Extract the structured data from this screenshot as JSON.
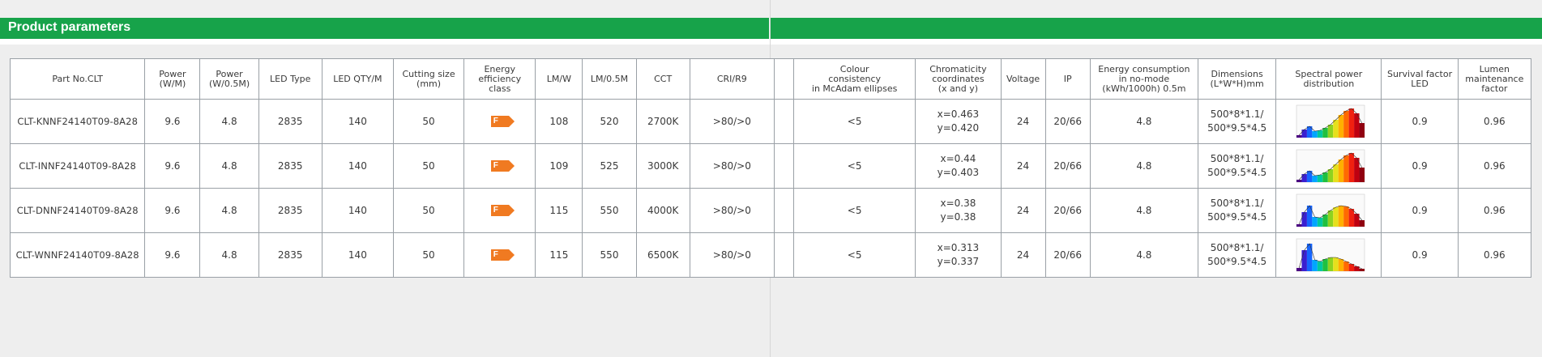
{
  "header": {
    "title": "Product parameters"
  },
  "table": {
    "headers": [
      "Part No.CLT",
      "Power\n(W/M)",
      "Power\n(W/0.5M)",
      "LED Type",
      "LED QTY/M",
      "Cutting size\n(mm)",
      "Energy\nefficiency\nclass",
      "LM/W",
      "LM/0.5M",
      "CCT",
      "CRI/R9",
      "",
      "Colour\nconsistency\nin McAdam ellipses",
      "Chromaticity\ncoordinates\n(x and y)",
      "Voltage",
      "IP",
      "Energy consumption\nin no-mode\n(kWh/1000h) 0.5m",
      "Dimensions\n(L*W*H)mm",
      "Spectral power\ndistribution",
      "Survival factor\nLED",
      "Lumen\nmaintenance\nfactor"
    ],
    "rows": [
      {
        "part_no": "CLT-KNNF24140T09-8A28",
        "power_m": "9.6",
        "power_half": "4.8",
        "led_type": "2835",
        "led_qty": "140",
        "cutting": "50",
        "energy_class": "F",
        "lmw": "108",
        "lm_half": "520",
        "cct": "2700K",
        "cri": ">80/>0",
        "mcadam": "<5",
        "chroma": "x=0.463\ny=0.420",
        "voltage": "24",
        "ip": "20/66",
        "consumption": "4.8",
        "dimensions": "500*8*1.1/\n500*9.5*4.5",
        "spectrum": "warm",
        "survival": "0.9",
        "lumen_maint": "0.96"
      },
      {
        "part_no": "CLT-INNF24140T09-8A28",
        "power_m": "9.6",
        "power_half": "4.8",
        "led_type": "2835",
        "led_qty": "140",
        "cutting": "50",
        "energy_class": "F",
        "lmw": "109",
        "lm_half": "525",
        "cct": "3000K",
        "cri": ">80/>0",
        "mcadam": "<5",
        "chroma": "x=0.44\ny=0.403",
        "voltage": "24",
        "ip": "20/66",
        "consumption": "4.8",
        "dimensions": "500*8*1.1/\n500*9.5*4.5",
        "spectrum": "warm",
        "survival": "0.9",
        "lumen_maint": "0.96"
      },
      {
        "part_no": "CLT-DNNF24140T09-8A28",
        "power_m": "9.6",
        "power_half": "4.8",
        "led_type": "2835",
        "led_qty": "140",
        "cutting": "50",
        "energy_class": "F",
        "lmw": "115",
        "lm_half": "550",
        "cct": "4000K",
        "cri": ">80/>0",
        "mcadam": "<5",
        "chroma": "x=0.38\ny=0.38",
        "voltage": "24",
        "ip": "20/66",
        "consumption": "4.8",
        "dimensions": "500*8*1.1/\n500*9.5*4.5",
        "spectrum": "neutral",
        "survival": "0.9",
        "lumen_maint": "0.96"
      },
      {
        "part_no": "CLT-WNNF24140T09-8A28",
        "power_m": "9.6",
        "power_half": "4.8",
        "led_type": "2835",
        "led_qty": "140",
        "cutting": "50",
        "energy_class": "F",
        "lmw": "115",
        "lm_half": "550",
        "cct": "6500K",
        "cri": ">80/>0",
        "mcadam": "<5",
        "chroma": "x=0.313\ny=0.337",
        "voltage": "24",
        "ip": "20/66",
        "consumption": "4.8",
        "dimensions": "500*8*1.1/\n500*9.5*4.5",
        "spectrum": "cool",
        "survival": "0.9",
        "lumen_maint": "0.96"
      }
    ]
  },
  "colors": {
    "band": "#17a34a",
    "energy_tag": "#f07a21",
    "border": "#9aa0a6"
  }
}
